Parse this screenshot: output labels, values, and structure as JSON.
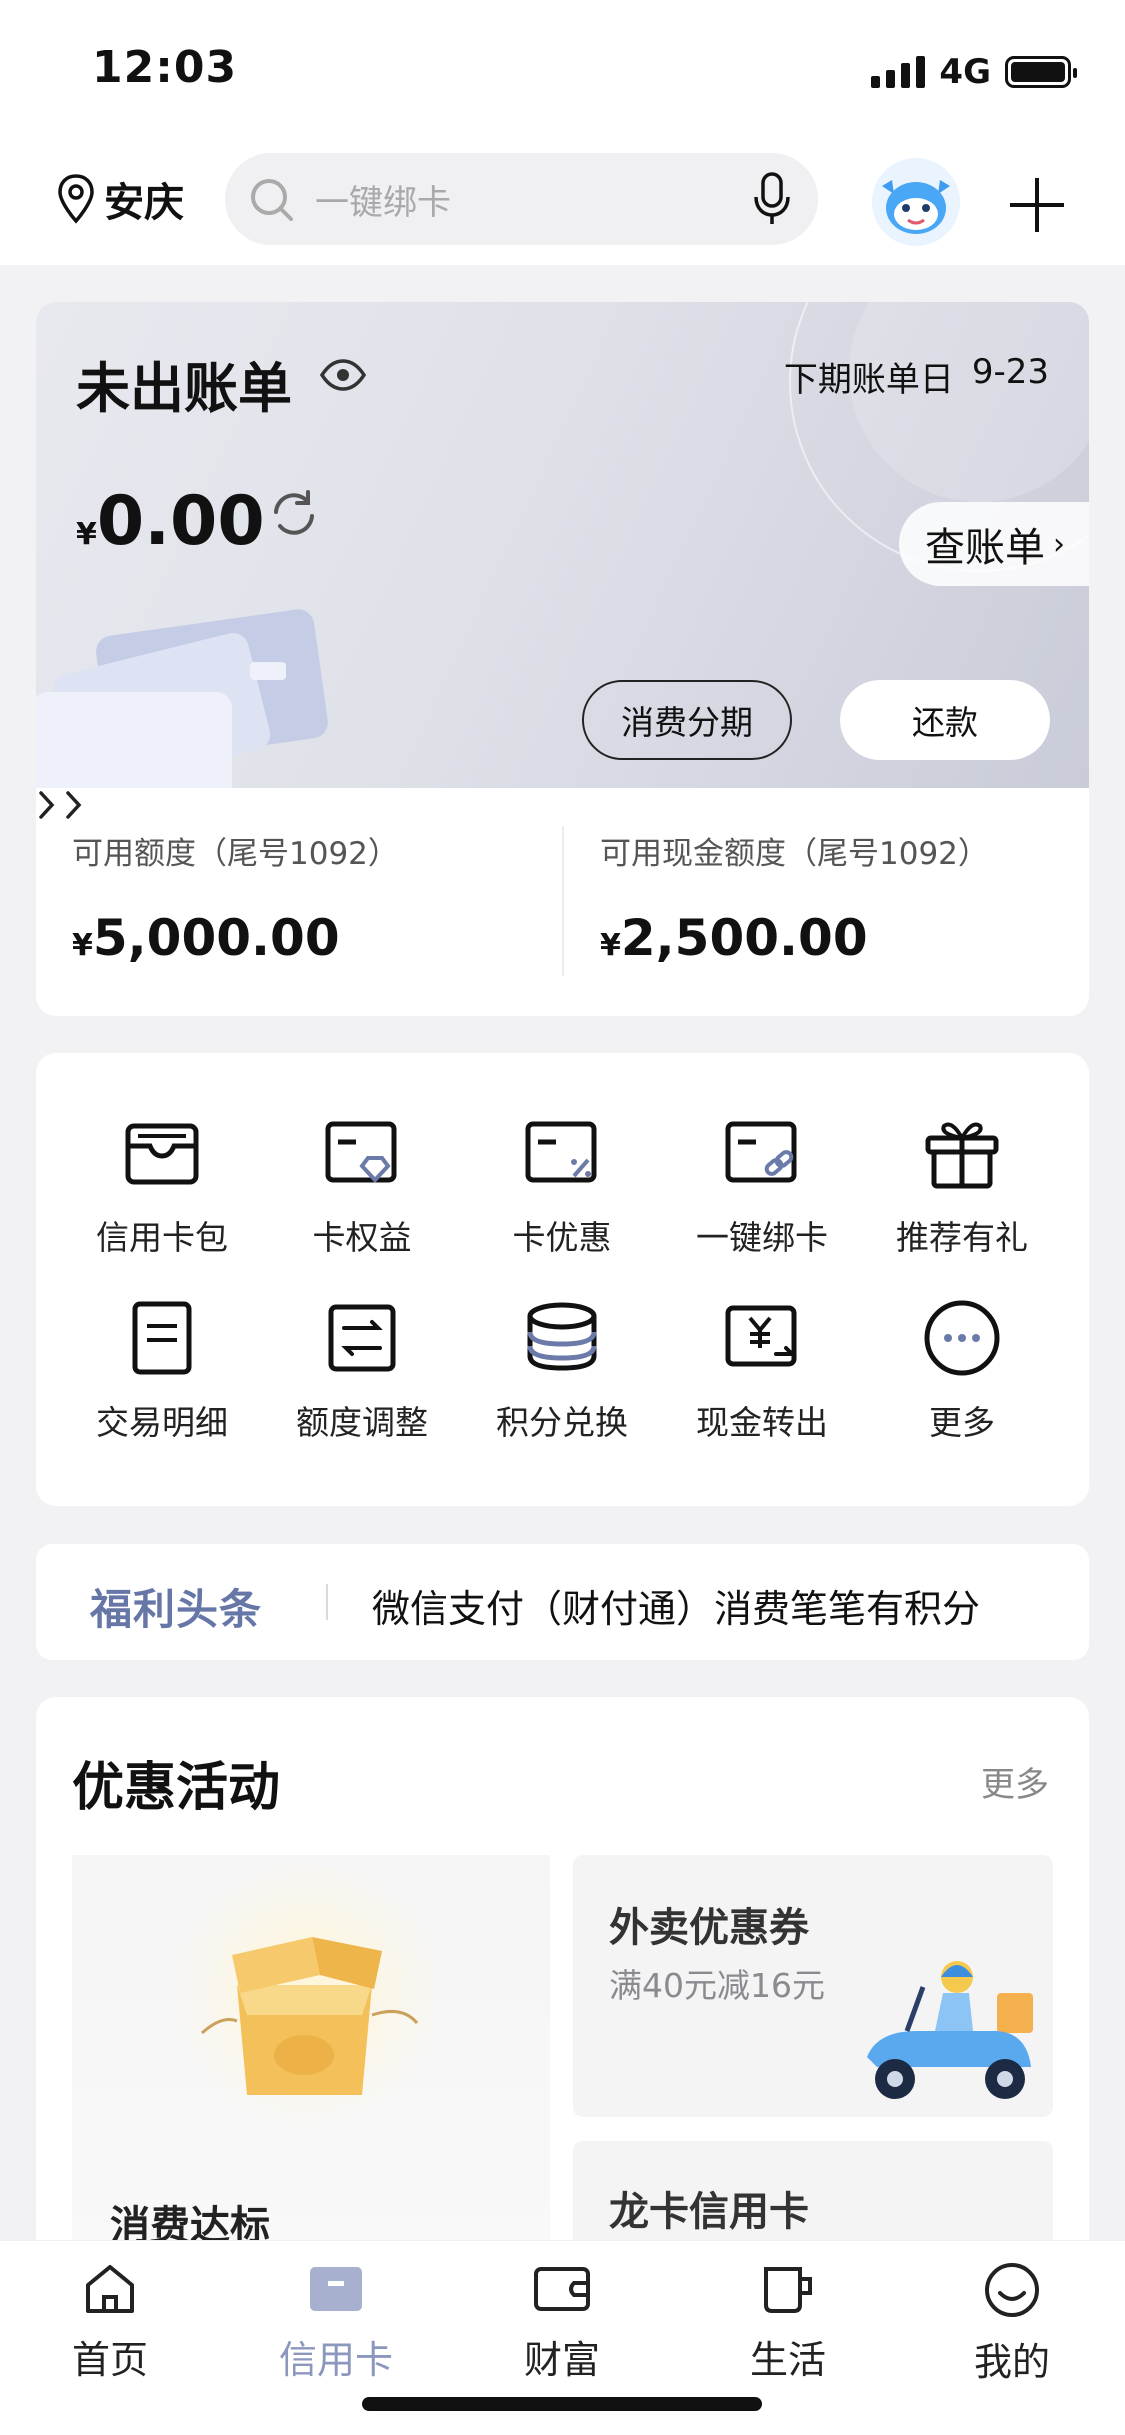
{
  "status_bar": {
    "time": "12:03",
    "network": "4G"
  },
  "header": {
    "location": "安庆",
    "search_placeholder": "一键绑卡"
  },
  "bill": {
    "title": "未出账单",
    "next_bill_label": "下期账单日",
    "next_bill_date": "9-23",
    "currency": "¥",
    "amount": "0.00",
    "query_label": "查账单",
    "installment_label": "消费分期",
    "repay_label": "还款"
  },
  "limits": {
    "available": {
      "label": "可用额度（尾号1092）",
      "currency": "¥",
      "value": "5,000.00"
    },
    "cash": {
      "label": "可用现金额度（尾号1092）",
      "currency": "¥",
      "value": "2,500.00"
    }
  },
  "functions": [
    {
      "label": "信用卡包",
      "icon": "card-wallet-icon"
    },
    {
      "label": "卡权益",
      "icon": "card-benefit-icon"
    },
    {
      "label": "卡优惠",
      "icon": "card-discount-icon"
    },
    {
      "label": "一键绑卡",
      "icon": "card-bind-icon"
    },
    {
      "label": "推荐有礼",
      "icon": "gift-icon"
    },
    {
      "label": "交易明细",
      "icon": "transaction-icon"
    },
    {
      "label": "额度调整",
      "icon": "limit-adjust-icon"
    },
    {
      "label": "积分兑换",
      "icon": "points-icon"
    },
    {
      "label": "现金转出",
      "icon": "cash-transfer-icon"
    },
    {
      "label": "更多",
      "icon": "more-icon"
    }
  ],
  "news": {
    "tag": "福利头条",
    "text": "微信支付（财付通）消费笔笔有积分"
  },
  "promo": {
    "title": "优惠活动",
    "more": "更多",
    "big_label": "消费达标",
    "card1_title": "外卖优惠券",
    "card1_subtitle": "满40元减16元",
    "card2_title": "龙卡信用卡"
  },
  "tabs": [
    {
      "label": "首页",
      "icon": "home-icon",
      "active": false
    },
    {
      "label": "信用卡",
      "icon": "credit-card-icon",
      "active": true
    },
    {
      "label": "财富",
      "icon": "wallet-icon",
      "active": false
    },
    {
      "label": "生活",
      "icon": "cup-icon",
      "active": false
    },
    {
      "label": "我的",
      "icon": "smile-icon",
      "active": false
    }
  ],
  "colors": {
    "accent": "#8c97bd",
    "news_tag": "#6676a6"
  }
}
